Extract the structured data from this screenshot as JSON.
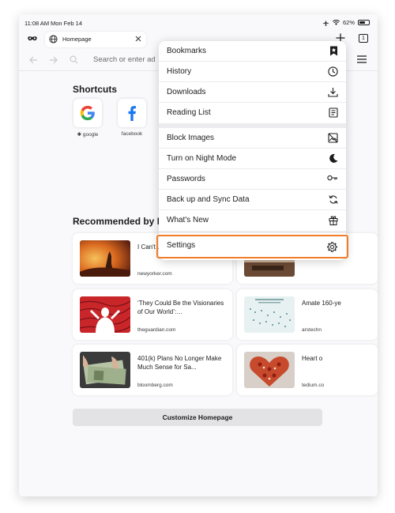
{
  "status": {
    "time": "11:08 AM",
    "date": "Mon Feb 14",
    "battery": "62%",
    "battery_fraction": 0.62
  },
  "tab": {
    "title": "Homepage",
    "count": "1"
  },
  "url": {
    "placeholder": "Search or enter ad"
  },
  "shortcuts": {
    "title": "Shortcuts",
    "items": [
      {
        "label": "google"
      },
      {
        "label": "facebook"
      }
    ]
  },
  "recommended": {
    "title": "Recommended by Po",
    "cards": [
      {
        "title": "I Can't… About…",
        "source": "newyorker.com"
      },
      {
        "title": "",
        "source": ""
      },
      {
        "title": "‘They Could Be the Visionaries of Our World’:…",
        "source": "theguardian.com"
      },
      {
        "title": "Amate 160-ye",
        "source": "arstechn"
      },
      {
        "title": "401(k) Plans No Longer Make Much Sense for Sa...",
        "source": "bloomberg.com"
      },
      {
        "title": "Heart o",
        "source": "tedium.co"
      }
    ]
  },
  "customize_label": "Customize Homepage",
  "menu": {
    "group1": [
      "Bookmarks",
      "History",
      "Downloads",
      "Reading List"
    ],
    "group2": [
      "Block Images",
      "Turn on Night Mode",
      "Passwords",
      "Back up and Sync Data",
      "What's New"
    ],
    "settings": "Settings"
  },
  "colors": {
    "highlight": "#f07d29",
    "background": "#f9f9fb"
  }
}
